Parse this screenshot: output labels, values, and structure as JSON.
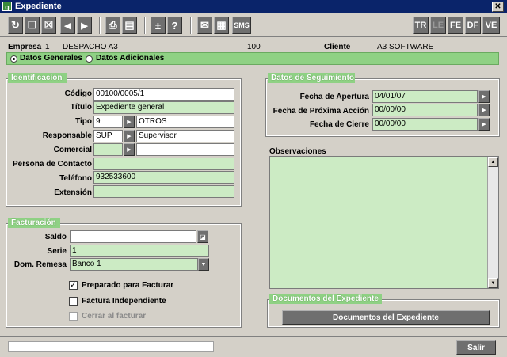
{
  "window": {
    "title": "Expediente",
    "app_icon": "g",
    "close": "✕"
  },
  "toolbar": {
    "left_buttons": [
      {
        "icon": "refresh-icon",
        "glyph": "↻"
      },
      {
        "icon": "new-icon",
        "glyph": "☐"
      },
      {
        "icon": "delete-icon",
        "glyph": "☒"
      },
      {
        "icon": "prev-icon",
        "glyph": "◀"
      },
      {
        "icon": "next-icon",
        "glyph": "▶"
      },
      {
        "icon": "print-icon",
        "glyph": "⎙"
      },
      {
        "icon": "list-icon",
        "glyph": "▤"
      },
      {
        "icon": "plus-minus-icon",
        "glyph": "±"
      },
      {
        "icon": "help-icon",
        "glyph": "?"
      },
      {
        "icon": "mail-icon",
        "glyph": "✉"
      },
      {
        "icon": "calendar-icon",
        "glyph": "▦"
      },
      {
        "icon": "sms-icon",
        "glyph": "SMS"
      }
    ],
    "right_buttons": [
      {
        "label": "TR",
        "enabled": true
      },
      {
        "label": "LE",
        "enabled": false
      },
      {
        "label": "FE",
        "enabled": true
      },
      {
        "label": "DF",
        "enabled": true
      },
      {
        "label": "VE",
        "enabled": true
      }
    ]
  },
  "header": {
    "empresa_label": "Empresa",
    "empresa_code": "1",
    "empresa_name": "DESPACHO A3",
    "number": "100",
    "cliente_label": "Cliente",
    "cliente_name": "A3 SOFTWARE"
  },
  "tabs": {
    "datos_generales": "Datos Generales",
    "datos_adicionales": "Datos Adicionales",
    "selected": "datos_generales"
  },
  "identificacion": {
    "title": "Identificación",
    "codigo_label": "Código",
    "codigo_value": "00100/0005/1",
    "titulo_label": "Título",
    "titulo_value": "Expediente general",
    "tipo_label": "Tipo",
    "tipo_code": "9",
    "tipo_desc": "OTROS",
    "responsable_label": "Responsable",
    "responsable_code": "SUP",
    "responsable_desc": "Supervisor",
    "comercial_label": "Comercial",
    "comercial_code": "",
    "comercial_desc": "",
    "persona_label": "Persona de  Contacto",
    "persona_value": "",
    "telefono_label": "Teléfono",
    "telefono_value": "932533600",
    "extension_label": "Extensión",
    "extension_value": ""
  },
  "seguimiento": {
    "title": "Datos de Seguimiento",
    "apertura_label": "Fecha de Apertura",
    "apertura_value": "04/01/07",
    "proxima_label": "Fecha de Próxima Acción",
    "proxima_value": "00/00/00",
    "cierre_label": "Fecha de Cierre",
    "cierre_value": "00/00/00"
  },
  "observaciones": {
    "label": "Observaciones",
    "value": ""
  },
  "facturacion": {
    "title": "Facturación",
    "saldo_label": "Saldo",
    "saldo_value": "",
    "serie_label": "Serie",
    "serie_value": "1",
    "remesa_label": "Dom. Remesa",
    "remesa_value": "Banco 1",
    "preparado_label": "Preparado para Facturar",
    "preparado_checked": true,
    "independiente_label": "Factura Independiente",
    "independiente_checked": false,
    "cerrar_label": "Cerrar al facturar",
    "cerrar_checked": false
  },
  "documentos": {
    "title": "Documentos del Expediente",
    "button_label": "Documentos del Expediente"
  },
  "status": {
    "text": "",
    "salir_label": "Salir"
  },
  "colors": {
    "titlebar": "#0a246a",
    "accent_green": "#8fd184",
    "field_green": "#ccebc4",
    "button_gray": "#6f6f6f",
    "face": "#d4d0c8"
  }
}
